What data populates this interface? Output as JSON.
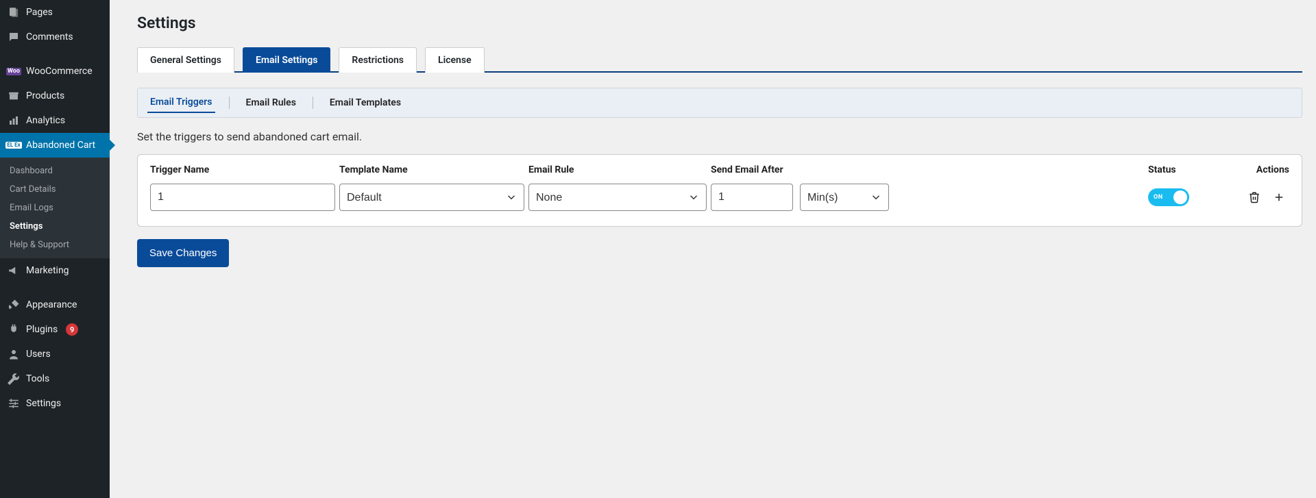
{
  "sidebar": {
    "items": [
      {
        "id": "pages",
        "label": "Pages"
      },
      {
        "id": "comments",
        "label": "Comments"
      },
      {
        "id": "woocommerce",
        "label": "WooCommerce",
        "badge_text": "Woo"
      },
      {
        "id": "products",
        "label": "Products"
      },
      {
        "id": "analytics",
        "label": "Analytics"
      },
      {
        "id": "abandoned_cart",
        "label": "Abandoned Cart",
        "badge_text": "EL Ex",
        "active": true,
        "submenu": [
          {
            "id": "dashboard",
            "label": "Dashboard"
          },
          {
            "id": "cart_details",
            "label": "Cart Details"
          },
          {
            "id": "email_logs",
            "label": "Email Logs"
          },
          {
            "id": "settings",
            "label": "Settings",
            "current": true
          },
          {
            "id": "help_support",
            "label": "Help & Support"
          }
        ]
      },
      {
        "id": "marketing",
        "label": "Marketing"
      },
      {
        "id": "appearance",
        "label": "Appearance"
      },
      {
        "id": "plugins",
        "label": "Plugins",
        "count": 9
      },
      {
        "id": "users",
        "label": "Users"
      },
      {
        "id": "tools",
        "label": "Tools"
      },
      {
        "id": "settings",
        "label": "Settings"
      }
    ]
  },
  "page": {
    "title": "Settings",
    "description": "Set the triggers to send abandoned cart email.",
    "save_label": "Save Changes"
  },
  "tabs": [
    {
      "id": "general",
      "label": "General Settings"
    },
    {
      "id": "email",
      "label": "Email Settings",
      "active": true
    },
    {
      "id": "restrictions",
      "label": "Restrictions"
    },
    {
      "id": "license",
      "label": "License"
    }
  ],
  "subtabs": [
    {
      "id": "triggers",
      "label": "Email Triggers",
      "active": true
    },
    {
      "id": "rules",
      "label": "Email Rules"
    },
    {
      "id": "templates",
      "label": "Email Templates"
    }
  ],
  "trigger_table": {
    "headers": {
      "name": "Trigger Name",
      "template": "Template Name",
      "rule": "Email Rule",
      "send_after": "Send Email After",
      "status": "Status",
      "actions": "Actions"
    },
    "row": {
      "name": "1",
      "template": "Default",
      "rule": "None",
      "send_after_value": "1",
      "send_after_unit": "Min(s)",
      "status_label": "ON",
      "status_on": true
    }
  }
}
